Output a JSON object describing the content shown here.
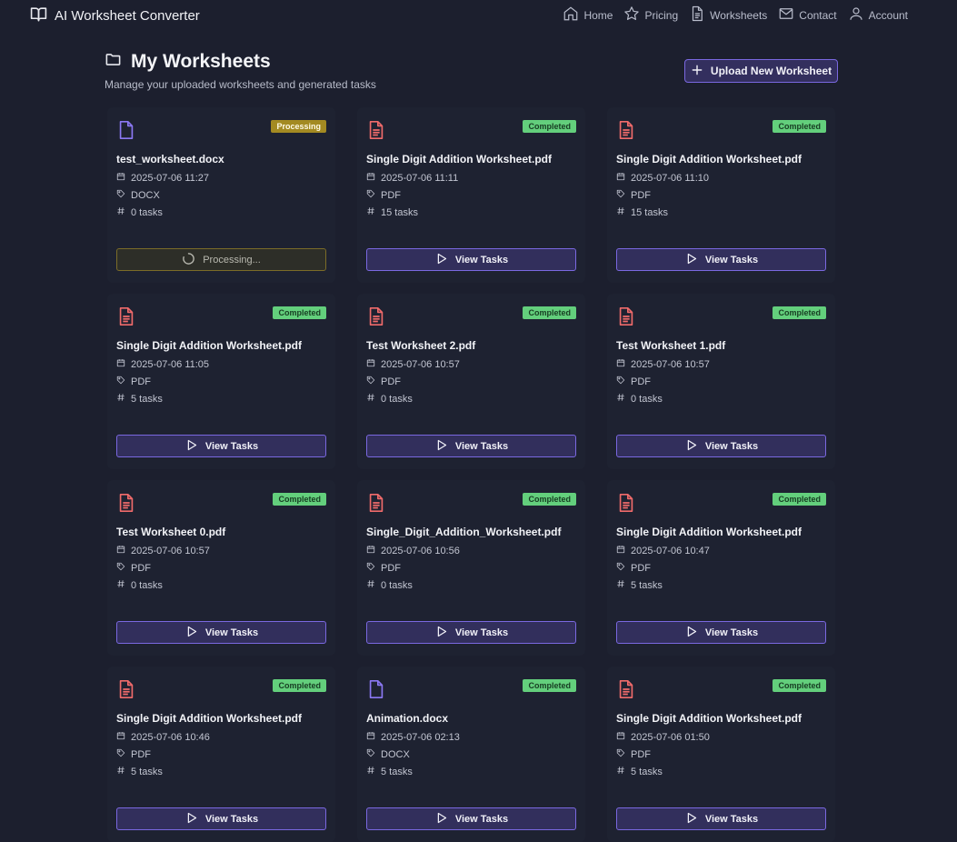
{
  "app": {
    "title": "AI Worksheet Converter"
  },
  "nav": [
    {
      "label": "Home",
      "icon": "home-icon"
    },
    {
      "label": "Pricing",
      "icon": "star-icon"
    },
    {
      "label": "Worksheets",
      "icon": "document-icon"
    },
    {
      "label": "Contact",
      "icon": "mail-icon"
    },
    {
      "label": "Account",
      "icon": "user-icon"
    }
  ],
  "page": {
    "title": "My Worksheets",
    "subtitle": "Manage your uploaded worksheets and generated tasks",
    "upload_label": "Upload New Worksheet"
  },
  "colors": {
    "pdf_icon": "#f06b6b",
    "docx_icon": "#8b78f3",
    "completed_badge": "#63cf7c",
    "processing_badge": "#a38a22",
    "accent_border": "#7a68e0"
  },
  "worksheets": [
    {
      "name": "test_worksheet.docx",
      "date": "2025-07-06 11:27",
      "type": "DOCX",
      "tasks": "0 tasks",
      "status": "Processing",
      "action": "Processing..."
    },
    {
      "name": "Single Digit Addition Worksheet.pdf",
      "date": "2025-07-06 11:11",
      "type": "PDF",
      "tasks": "15 tasks",
      "status": "Completed",
      "action": "View Tasks"
    },
    {
      "name": "Single Digit Addition Worksheet.pdf",
      "date": "2025-07-06 11:10",
      "type": "PDF",
      "tasks": "15 tasks",
      "status": "Completed",
      "action": "View Tasks"
    },
    {
      "name": "Single Digit Addition Worksheet.pdf",
      "date": "2025-07-06 11:05",
      "type": "PDF",
      "tasks": "5 tasks",
      "status": "Completed",
      "action": "View Tasks"
    },
    {
      "name": "Test Worksheet 2.pdf",
      "date": "2025-07-06 10:57",
      "type": "PDF",
      "tasks": "0 tasks",
      "status": "Completed",
      "action": "View Tasks"
    },
    {
      "name": "Test Worksheet 1.pdf",
      "date": "2025-07-06 10:57",
      "type": "PDF",
      "tasks": "0 tasks",
      "status": "Completed",
      "action": "View Tasks"
    },
    {
      "name": "Test Worksheet 0.pdf",
      "date": "2025-07-06 10:57",
      "type": "PDF",
      "tasks": "0 tasks",
      "status": "Completed",
      "action": "View Tasks"
    },
    {
      "name": "Single_Digit_Addition_Worksheet.pdf",
      "date": "2025-07-06 10:56",
      "type": "PDF",
      "tasks": "0 tasks",
      "status": "Completed",
      "action": "View Tasks"
    },
    {
      "name": "Single Digit Addition Worksheet.pdf",
      "date": "2025-07-06 10:47",
      "type": "PDF",
      "tasks": "5 tasks",
      "status": "Completed",
      "action": "View Tasks"
    },
    {
      "name": "Single Digit Addition Worksheet.pdf",
      "date": "2025-07-06 10:46",
      "type": "PDF",
      "tasks": "5 tasks",
      "status": "Completed",
      "action": "View Tasks"
    },
    {
      "name": "Animation.docx",
      "date": "2025-07-06 02:13",
      "type": "DOCX",
      "tasks": "5 tasks",
      "status": "Completed",
      "action": "View Tasks"
    },
    {
      "name": "Single Digit Addition Worksheet.pdf",
      "date": "2025-07-06 01:50",
      "type": "PDF",
      "tasks": "5 tasks",
      "status": "Completed",
      "action": "View Tasks"
    }
  ]
}
